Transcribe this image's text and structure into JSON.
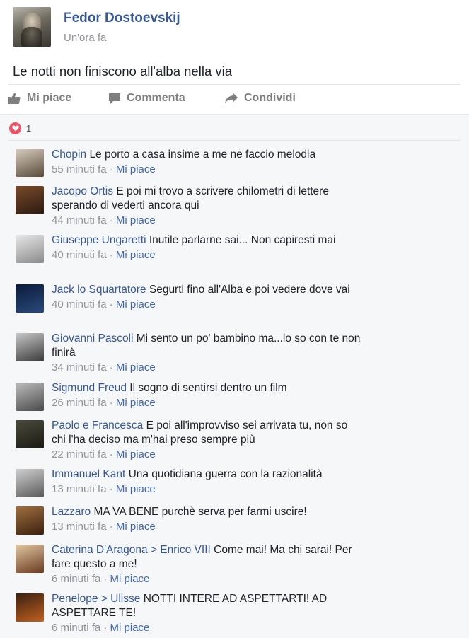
{
  "post": {
    "author": "Fedor Dostoevskij",
    "time": "Un'ora fa",
    "text": "Le notti non finiscono all'alba nella via"
  },
  "actions": {
    "like": "Mi piace",
    "comment": "Commenta",
    "share": "Condividi"
  },
  "reactions": {
    "count": "1",
    "color": "#f25268"
  },
  "comments": [
    {
      "name": "Chopin",
      "text": "Le porto a casa insime a me ne faccio melodia",
      "time": "55 minuti fa",
      "like": "Mi piace"
    },
    {
      "name": "Jacopo Ortis",
      "text": "E poi mi trovo a scrivere chilometri di lettere sperando di vederti ancora qui",
      "time": "44 minuti fa",
      "like": "Mi piace"
    },
    {
      "name": "Giuseppe Ungaretti",
      "text": "Inutile parlarne sai... Non capiresti mai",
      "time": "40 minuti fa",
      "like": "Mi piace"
    },
    {
      "name": "Jack lo Squartatore",
      "text": "Segurti fino all'Alba e poi vedere dove vai",
      "time": "40 minuti fa",
      "like": "Mi piace"
    },
    {
      "name": "Giovanni Pascoli",
      "text": "Mi sento un po' bambino ma...lo so con te non finirà",
      "time": "34 minuti fa",
      "like": "Mi piace"
    },
    {
      "name": "Sigmund Freud",
      "text": "Il sogno di sentirsi dentro un film",
      "time": "26 minuti fa",
      "like": "Mi piace"
    },
    {
      "name": "Paolo e Francesca",
      "text": "E poi all'improvviso sei arrivata tu, non so chi l'ha deciso ma m'hai preso sempre più",
      "time": "22 minuti fa",
      "like": "Mi piace"
    },
    {
      "name": "Immanuel Kant",
      "text": "Una quotidiana guerra con la razionalità",
      "time": "13 minuti fa",
      "like": "Mi piace"
    },
    {
      "name": "Lazzaro",
      "text": "MA VA BENE purchè serva per farmi uscire!",
      "time": "13 minuti fa",
      "like": "Mi piace"
    },
    {
      "name": "Caterina D'Aragona > Enrico VIII",
      "text": "Come mai! Ma chi sarai! Per fare questo a me!",
      "time": "6 minuti fa",
      "like": "Mi piace"
    },
    {
      "name": "Penelope > Ulisse",
      "text": "NOTTI INTERE AD ASPETTARTI! AD ASPETTARE TE!",
      "time": "6 minuti fa",
      "like": "Mi piace"
    }
  ],
  "colors": {
    "link_blue": "#365899",
    "meta_gray": "#90949c",
    "like_blue": "#4267b2",
    "comments_bg": "#f6f7f9"
  }
}
